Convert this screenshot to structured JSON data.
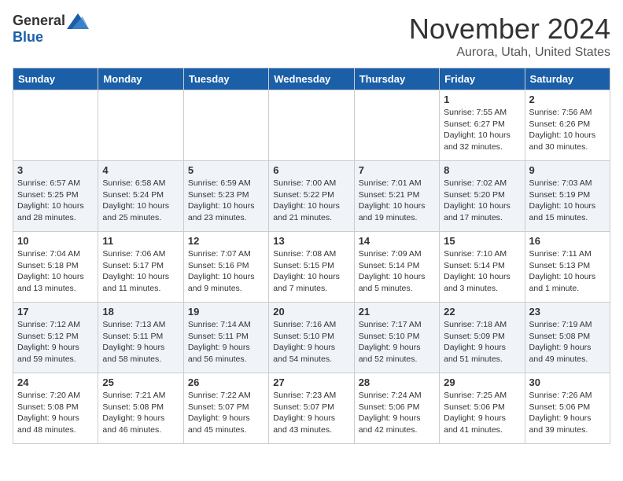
{
  "logo": {
    "general": "General",
    "blue": "Blue"
  },
  "header": {
    "month": "November 2024",
    "location": "Aurora, Utah, United States"
  },
  "weekdays": [
    "Sunday",
    "Monday",
    "Tuesday",
    "Wednesday",
    "Thursday",
    "Friday",
    "Saturday"
  ],
  "weeks": [
    [
      {
        "day": "",
        "info": ""
      },
      {
        "day": "",
        "info": ""
      },
      {
        "day": "",
        "info": ""
      },
      {
        "day": "",
        "info": ""
      },
      {
        "day": "",
        "info": ""
      },
      {
        "day": "1",
        "info": "Sunrise: 7:55 AM\nSunset: 6:27 PM\nDaylight: 10 hours and 32 minutes."
      },
      {
        "day": "2",
        "info": "Sunrise: 7:56 AM\nSunset: 6:26 PM\nDaylight: 10 hours and 30 minutes."
      }
    ],
    [
      {
        "day": "3",
        "info": "Sunrise: 6:57 AM\nSunset: 5:25 PM\nDaylight: 10 hours and 28 minutes."
      },
      {
        "day": "4",
        "info": "Sunrise: 6:58 AM\nSunset: 5:24 PM\nDaylight: 10 hours and 25 minutes."
      },
      {
        "day": "5",
        "info": "Sunrise: 6:59 AM\nSunset: 5:23 PM\nDaylight: 10 hours and 23 minutes."
      },
      {
        "day": "6",
        "info": "Sunrise: 7:00 AM\nSunset: 5:22 PM\nDaylight: 10 hours and 21 minutes."
      },
      {
        "day": "7",
        "info": "Sunrise: 7:01 AM\nSunset: 5:21 PM\nDaylight: 10 hours and 19 minutes."
      },
      {
        "day": "8",
        "info": "Sunrise: 7:02 AM\nSunset: 5:20 PM\nDaylight: 10 hours and 17 minutes."
      },
      {
        "day": "9",
        "info": "Sunrise: 7:03 AM\nSunset: 5:19 PM\nDaylight: 10 hours and 15 minutes."
      }
    ],
    [
      {
        "day": "10",
        "info": "Sunrise: 7:04 AM\nSunset: 5:18 PM\nDaylight: 10 hours and 13 minutes."
      },
      {
        "day": "11",
        "info": "Sunrise: 7:06 AM\nSunset: 5:17 PM\nDaylight: 10 hours and 11 minutes."
      },
      {
        "day": "12",
        "info": "Sunrise: 7:07 AM\nSunset: 5:16 PM\nDaylight: 10 hours and 9 minutes."
      },
      {
        "day": "13",
        "info": "Sunrise: 7:08 AM\nSunset: 5:15 PM\nDaylight: 10 hours and 7 minutes."
      },
      {
        "day": "14",
        "info": "Sunrise: 7:09 AM\nSunset: 5:14 PM\nDaylight: 10 hours and 5 minutes."
      },
      {
        "day": "15",
        "info": "Sunrise: 7:10 AM\nSunset: 5:14 PM\nDaylight: 10 hours and 3 minutes."
      },
      {
        "day": "16",
        "info": "Sunrise: 7:11 AM\nSunset: 5:13 PM\nDaylight: 10 hours and 1 minute."
      }
    ],
    [
      {
        "day": "17",
        "info": "Sunrise: 7:12 AM\nSunset: 5:12 PM\nDaylight: 9 hours and 59 minutes."
      },
      {
        "day": "18",
        "info": "Sunrise: 7:13 AM\nSunset: 5:11 PM\nDaylight: 9 hours and 58 minutes."
      },
      {
        "day": "19",
        "info": "Sunrise: 7:14 AM\nSunset: 5:11 PM\nDaylight: 9 hours and 56 minutes."
      },
      {
        "day": "20",
        "info": "Sunrise: 7:16 AM\nSunset: 5:10 PM\nDaylight: 9 hours and 54 minutes."
      },
      {
        "day": "21",
        "info": "Sunrise: 7:17 AM\nSunset: 5:10 PM\nDaylight: 9 hours and 52 minutes."
      },
      {
        "day": "22",
        "info": "Sunrise: 7:18 AM\nSunset: 5:09 PM\nDaylight: 9 hours and 51 minutes."
      },
      {
        "day": "23",
        "info": "Sunrise: 7:19 AM\nSunset: 5:08 PM\nDaylight: 9 hours and 49 minutes."
      }
    ],
    [
      {
        "day": "24",
        "info": "Sunrise: 7:20 AM\nSunset: 5:08 PM\nDaylight: 9 hours and 48 minutes."
      },
      {
        "day": "25",
        "info": "Sunrise: 7:21 AM\nSunset: 5:08 PM\nDaylight: 9 hours and 46 minutes."
      },
      {
        "day": "26",
        "info": "Sunrise: 7:22 AM\nSunset: 5:07 PM\nDaylight: 9 hours and 45 minutes."
      },
      {
        "day": "27",
        "info": "Sunrise: 7:23 AM\nSunset: 5:07 PM\nDaylight: 9 hours and 43 minutes."
      },
      {
        "day": "28",
        "info": "Sunrise: 7:24 AM\nSunset: 5:06 PM\nDaylight: 9 hours and 42 minutes."
      },
      {
        "day": "29",
        "info": "Sunrise: 7:25 AM\nSunset: 5:06 PM\nDaylight: 9 hours and 41 minutes."
      },
      {
        "day": "30",
        "info": "Sunrise: 7:26 AM\nSunset: 5:06 PM\nDaylight: 9 hours and 39 minutes."
      }
    ]
  ]
}
